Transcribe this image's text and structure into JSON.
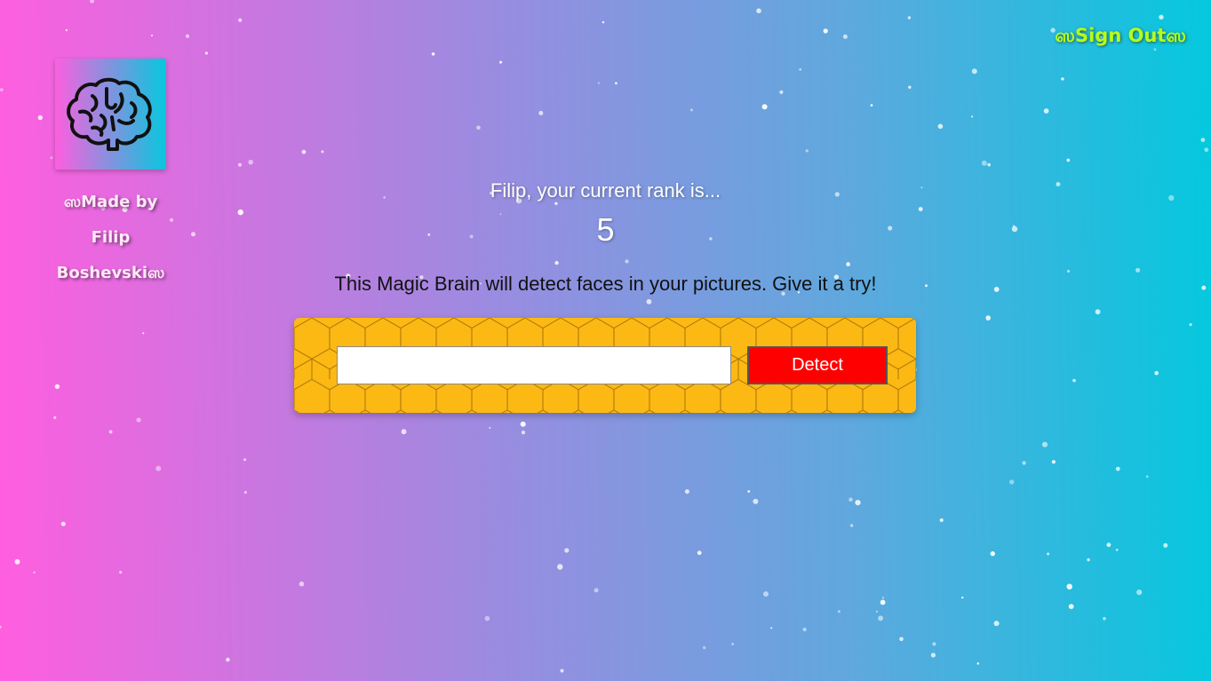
{
  "nav": {
    "signout_label": "ஸSign Outஸ"
  },
  "logo": {
    "icon": "brain-icon"
  },
  "credit": {
    "line1": "ஸMade by",
    "line2": "Filip",
    "line3": "Boshevskiஸ"
  },
  "rank": {
    "message": "Filip, your current rank is...",
    "value": "5"
  },
  "intro": {
    "text": "This Magic Brain will detect faces in your pictures. Give it a try!"
  },
  "form": {
    "input_value": "",
    "button_label": "Detect"
  },
  "colors": {
    "gradient_start": "#ff5edf",
    "gradient_end": "#04c8de",
    "signout": "#b4ff1e",
    "panel": "#fcb913",
    "button": "#ff0000"
  }
}
